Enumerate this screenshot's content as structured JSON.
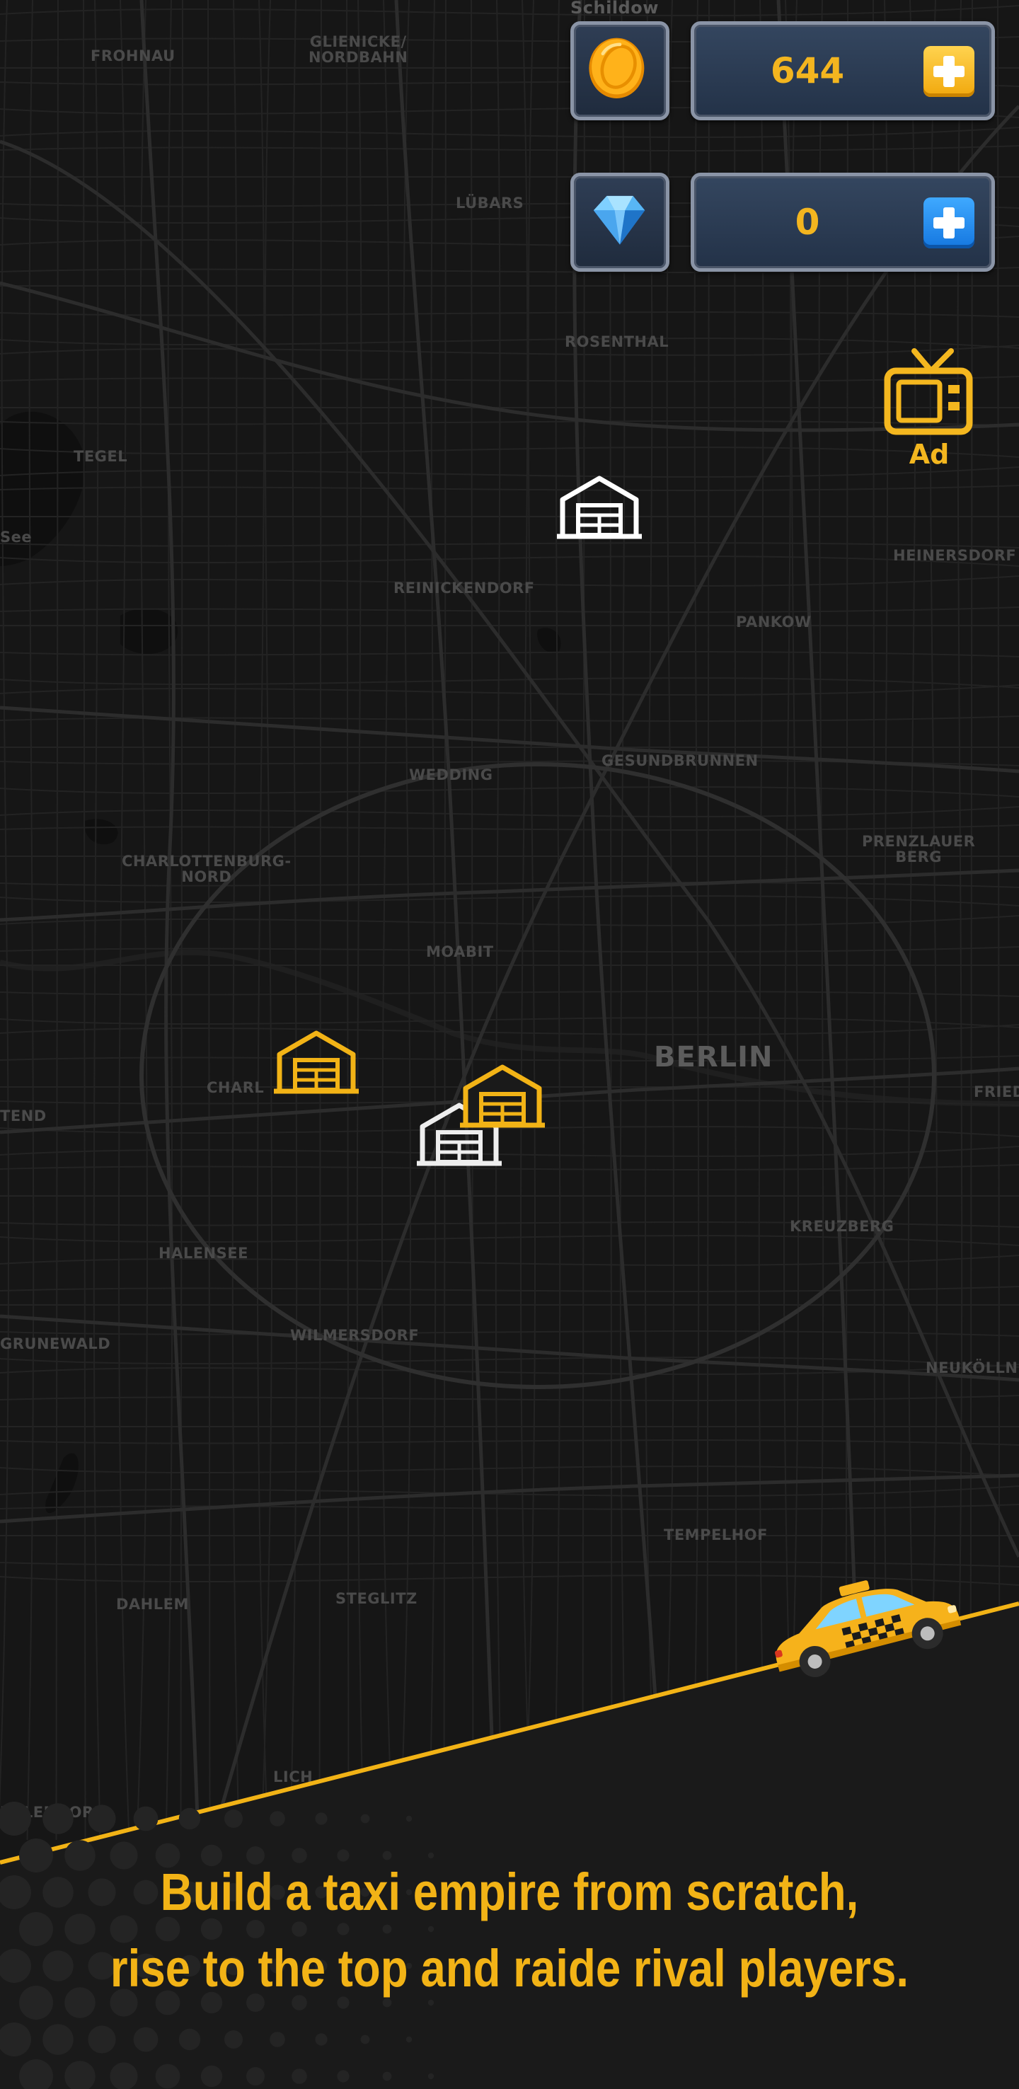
{
  "hud": {
    "coins": {
      "value": "644",
      "icon": "coin-icon",
      "plus_icon": "plus-icon",
      "accent": "#f3b51f"
    },
    "gems": {
      "value": "0",
      "icon": "diamond-icon",
      "plus_icon": "plus-icon",
      "accent": "#1e88f0"
    },
    "ad": {
      "label": "Ad",
      "icon": "tv-icon"
    }
  },
  "map": {
    "city_label": "BERLIN",
    "districts": [
      "Schildow",
      "FROHNAU",
      "GLIENICKE/\nNORDBAHN",
      "LÜBARS",
      "ROSENTHAL",
      "TEGEL",
      "See",
      "HEINERSDORF",
      "REINICKENDORF",
      "PANKOW",
      "WEDDING",
      "GESUNDBRUNNEN",
      "CHARLOTTENBURG-\nNORD",
      "PRENZLAUER\nBERG",
      "MOABIT",
      "CHARL",
      "FRIED",
      "TEND",
      "HALENSEE",
      "KREUZBERG",
      "WILMERSDORF",
      "GRUNEWALD",
      "NEUKÖLLN",
      "TEMPELHOF",
      "DAHLEM",
      "STEGLITZ",
      "LICH",
      "EHLENDORF"
    ]
  },
  "banner": {
    "tagline_line1": "Build a taxi empire from scratch,",
    "tagline_line2": "rise to the top and raide rival players."
  },
  "colors": {
    "accent_yellow": "#f2b316",
    "map_bg": "#161616"
  }
}
